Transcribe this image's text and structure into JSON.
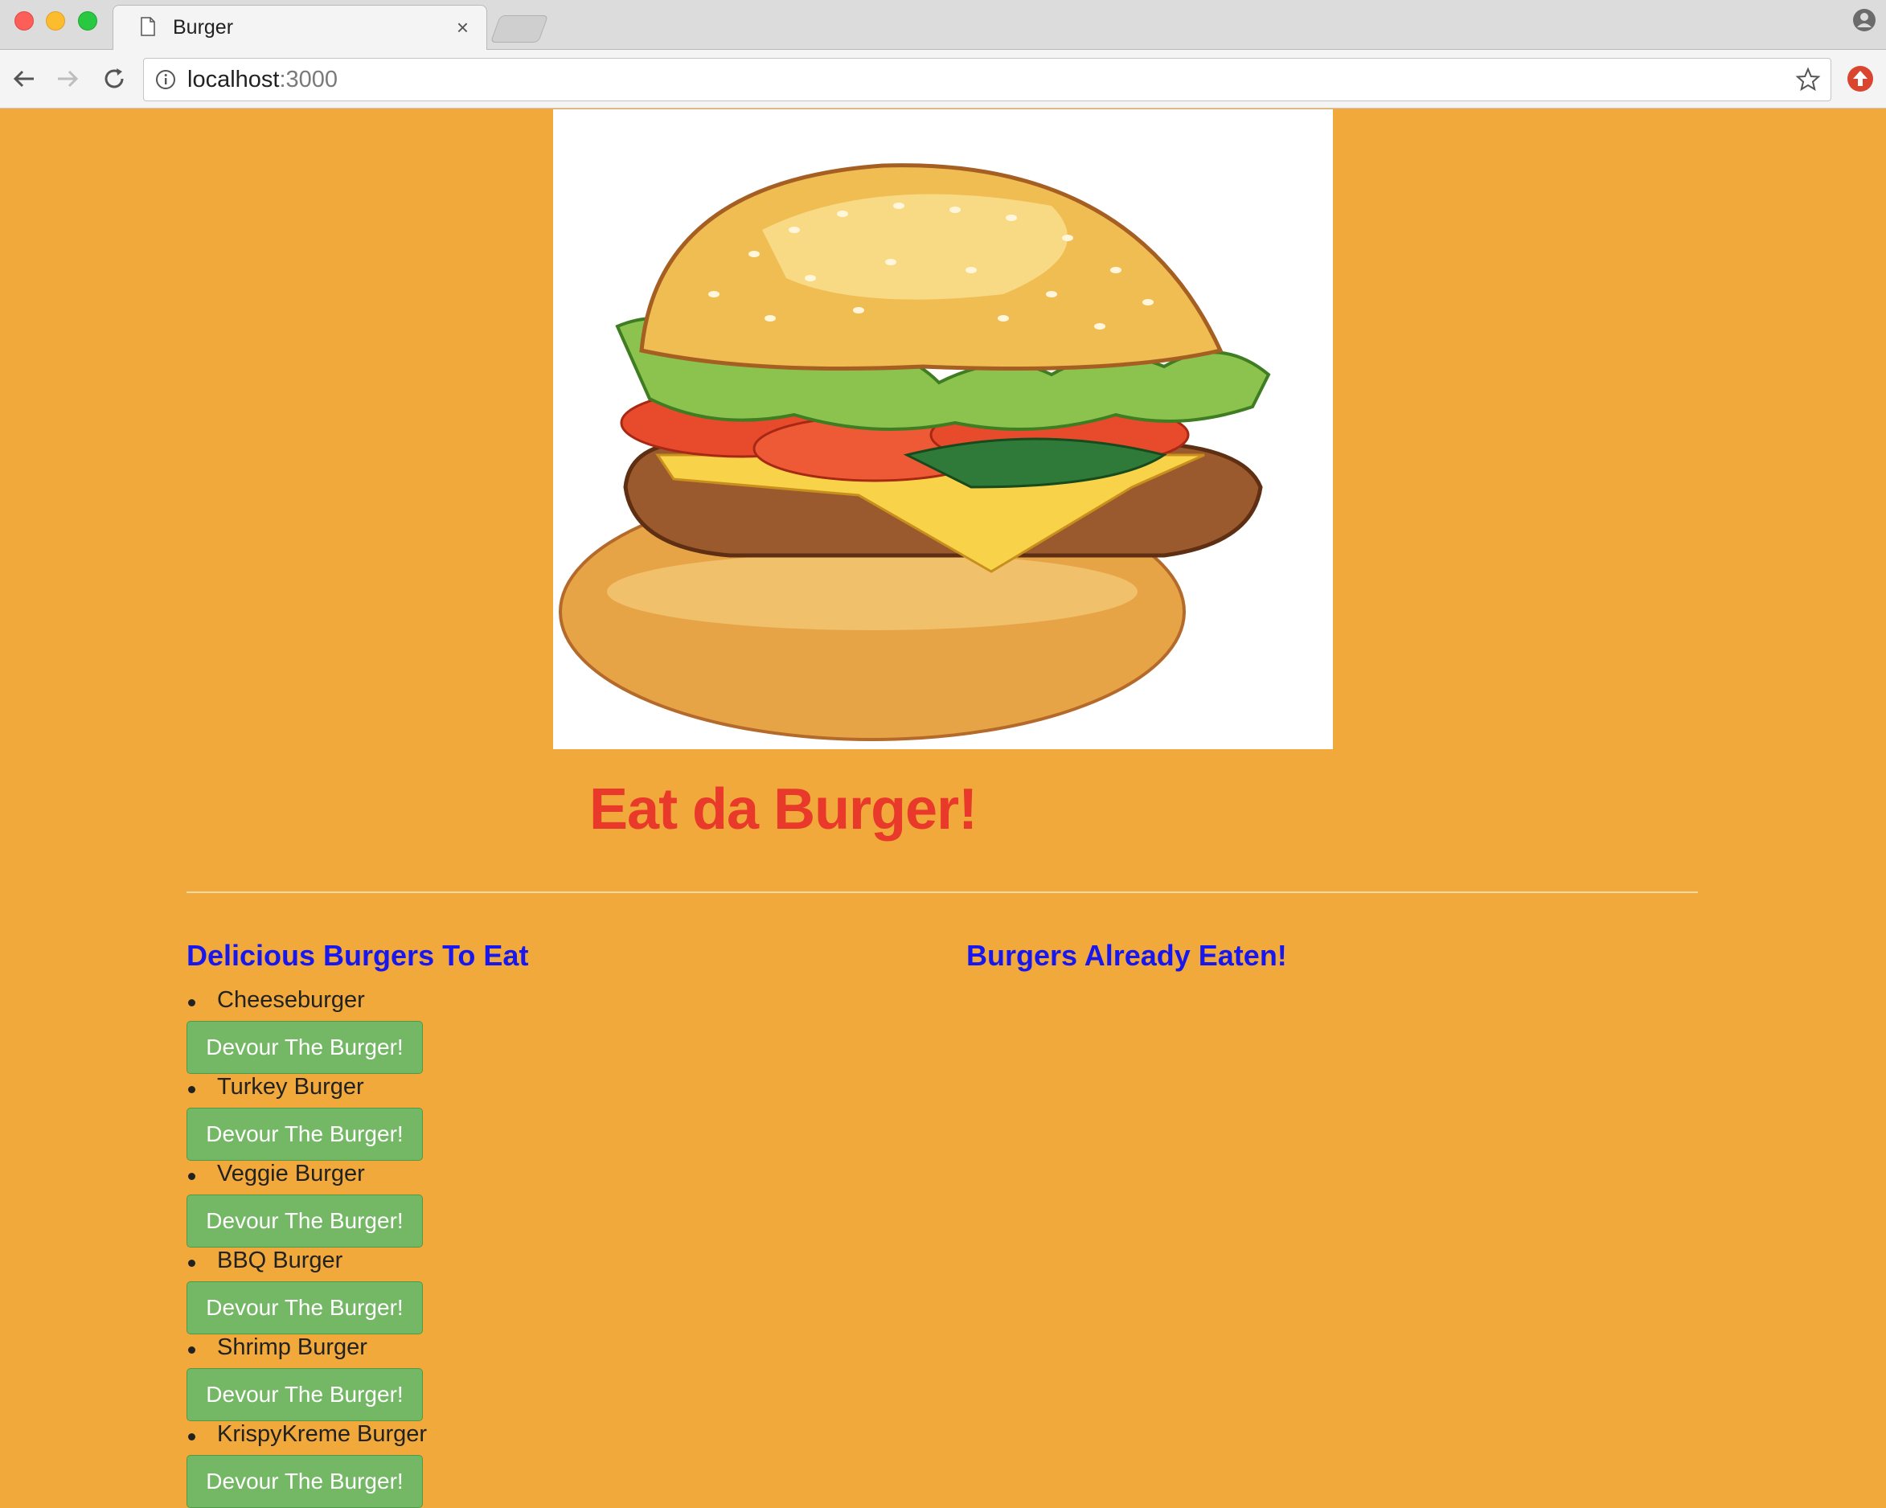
{
  "browser": {
    "tab_title": "Burger",
    "tab_close": "×",
    "url_host": "localhost",
    "url_port": ":3000"
  },
  "page": {
    "title": "Eat da Burger!",
    "left_heading": "Delicious Burgers To Eat",
    "right_heading": "Burgers Already Eaten!",
    "burgers": [
      {
        "name": "Cheeseburger",
        "button": "Devour The Burger!"
      },
      {
        "name": "Turkey Burger",
        "button": "Devour The Burger!"
      },
      {
        "name": "Veggie Burger",
        "button": "Devour The Burger!"
      },
      {
        "name": "BBQ Burger",
        "button": "Devour The Burger!"
      },
      {
        "name": "Shrimp Burger",
        "button": "Devour The Burger!"
      },
      {
        "name": "KrispyKreme Burger",
        "button": "Devour The Burger!"
      }
    ],
    "eaten": []
  },
  "colors": {
    "background": "#f2a93b",
    "title": "#e8392a",
    "headings": "#1818ee",
    "button": "#74b865"
  },
  "icons": [
    "document-icon",
    "back-arrow-icon",
    "forward-arrow-icon",
    "reload-icon",
    "info-icon",
    "star-icon",
    "extension-icon",
    "profile-icon",
    "burger-image"
  ]
}
